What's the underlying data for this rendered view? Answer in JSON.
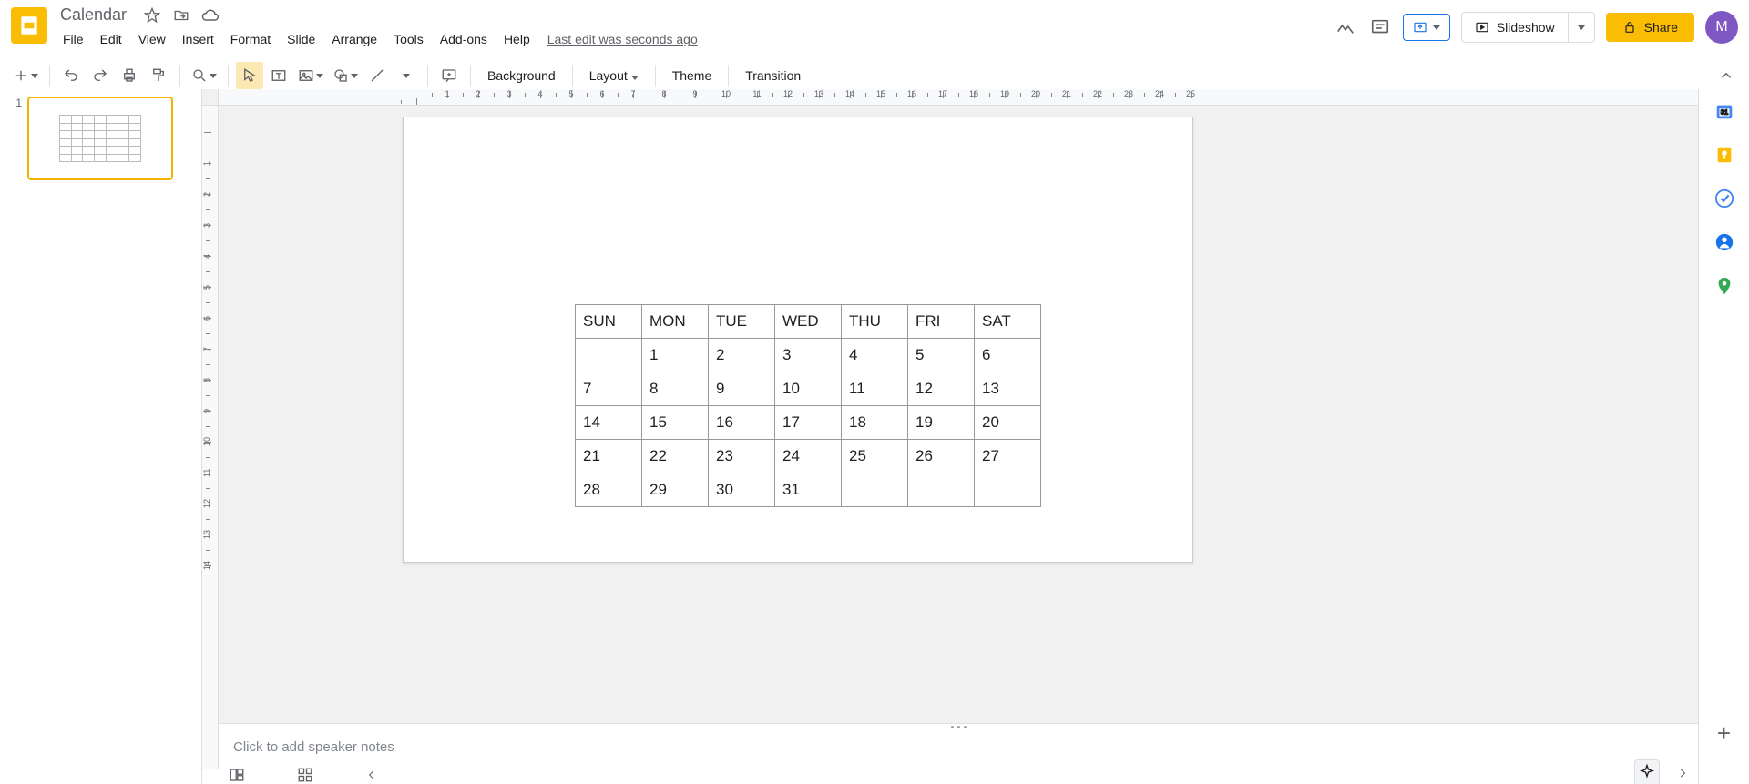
{
  "doc": {
    "title": "Calendar",
    "last_edit": "Last edit was seconds ago"
  },
  "menus": [
    "File",
    "Edit",
    "View",
    "Insert",
    "Format",
    "Slide",
    "Arrange",
    "Tools",
    "Add-ons",
    "Help"
  ],
  "header_right": {
    "slideshow": "Slideshow",
    "share": "Share",
    "avatar_initial": "M"
  },
  "toolbar": {
    "background": "Background",
    "layout": "Layout",
    "theme": "Theme",
    "transition": "Transition"
  },
  "ruler_h": [
    "",
    "1",
    "2",
    "3",
    "4",
    "5",
    "6",
    "7",
    "8",
    "9",
    "10",
    "11",
    "12",
    "13",
    "14",
    "15",
    "16",
    "17",
    "18",
    "19",
    "20",
    "21",
    "22",
    "23",
    "24",
    "25"
  ],
  "ruler_v": [
    "",
    "1",
    "2",
    "3",
    "4",
    "5",
    "6",
    "7",
    "8",
    "9",
    "10",
    "11",
    "12",
    "13",
    "14"
  ],
  "filmstrip": {
    "slide_number": "1"
  },
  "calendar": {
    "headers": [
      "SUN",
      "MON",
      "TUE",
      "WED",
      "THU",
      "FRI",
      "SAT"
    ],
    "rows": [
      [
        "",
        "1",
        "2",
        "3",
        "4",
        "5",
        "6"
      ],
      [
        "7",
        "8",
        "9",
        "10",
        "11",
        "12",
        "13"
      ],
      [
        "14",
        "15",
        "16",
        "17",
        "18",
        "19",
        "20"
      ],
      [
        "21",
        "22",
        "23",
        "24",
        "25",
        "26",
        "27"
      ],
      [
        "28",
        "29",
        "30",
        "31",
        "",
        "",
        ""
      ]
    ]
  },
  "speaker_notes_placeholder": "Click to add speaker notes"
}
